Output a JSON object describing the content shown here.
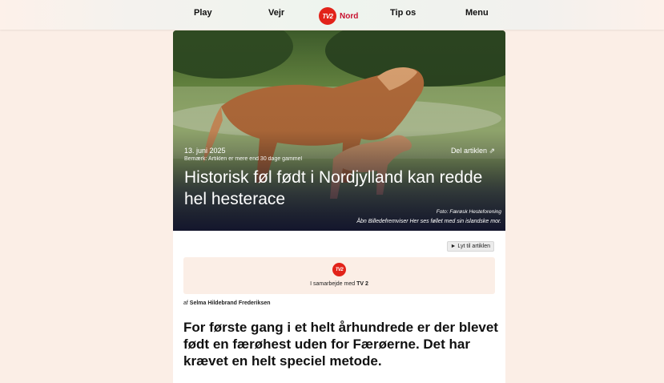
{
  "nav": {
    "play": "Play",
    "weather": "Vejr",
    "logo_text": "TV2",
    "region": "Nord",
    "tip": "Tip os",
    "menu": "Menu"
  },
  "article": {
    "date": "13. juni 2025",
    "notice": "Bemærk: Artiklen er mere end 30 dage gammel",
    "share": "Del artiklen ⇗",
    "headline": "Historisk føl født i Nordjylland kan redde hel hesterace",
    "photo_credit": "Foto: Færøsk Hesteforening",
    "photo_caption": "Åbn Billedefremviser Her ses føllet med sin islandske mor.",
    "listen": "► Lyt til artiklen",
    "collab_prefix": "I samarbejde med ",
    "collab_partner": "TV 2",
    "byline_prefix": "af ",
    "author": "Selma Hildebrand Frederiksen",
    "lead": "For første gang i et helt århundrede er der blevet født en færøhest uden for Færøerne. Det har krævet en helt speciel metode."
  },
  "colors": {
    "brand_red": "#e2231a",
    "page_bg": "#fbeee6"
  }
}
